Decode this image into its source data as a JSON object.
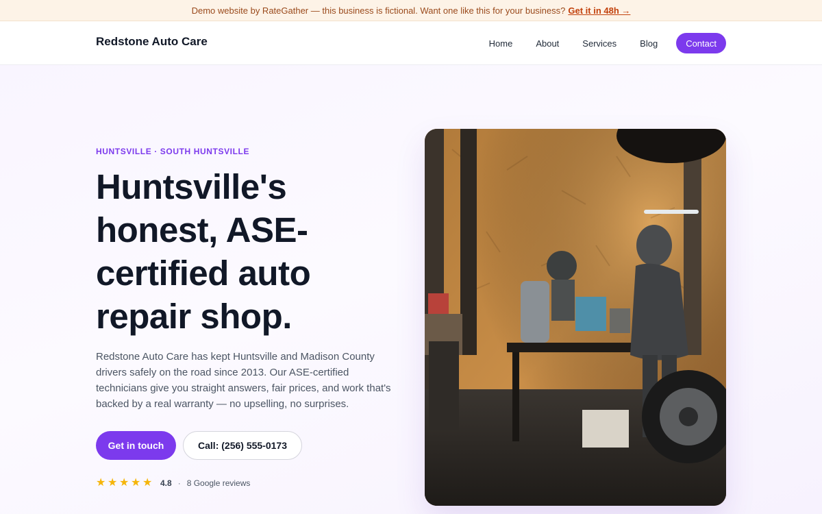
{
  "banner": {
    "text": "Demo website by RateGather — this business is fictional. Want one like this for your business?",
    "link_label": "Get it in 48h →"
  },
  "nav": {
    "brand": "Redstone Auto Care",
    "links": [
      "Home",
      "About",
      "Services",
      "Blog"
    ],
    "cta": "Contact"
  },
  "hero": {
    "eyebrow": "HUNTSVILLE · SOUTH HUNTSVILLE",
    "headline": "Huntsville's honest, ASE-certified auto repair shop.",
    "lead": "Redstone Auto Care has kept Huntsville and Madison County drivers safely on the road since 2013. Our ASE-certified technicians give you straight answers, fair prices, and work that's backed by a real warranty — no upselling, no surprises.",
    "primary_button": "Get in touch",
    "secondary_button": "Call: (256) 555-0173",
    "rating": {
      "stars": 5,
      "value": "4.8",
      "separator": "·",
      "reviews": "8 Google reviews"
    },
    "photo_icon": "auto-shop-photo"
  },
  "colors": {
    "accent": "#7c3aed",
    "banner_bg": "#fdf3e7",
    "banner_text": "#9a4a1c",
    "banner_link": "#c2410c",
    "star": "#f5b50a"
  }
}
